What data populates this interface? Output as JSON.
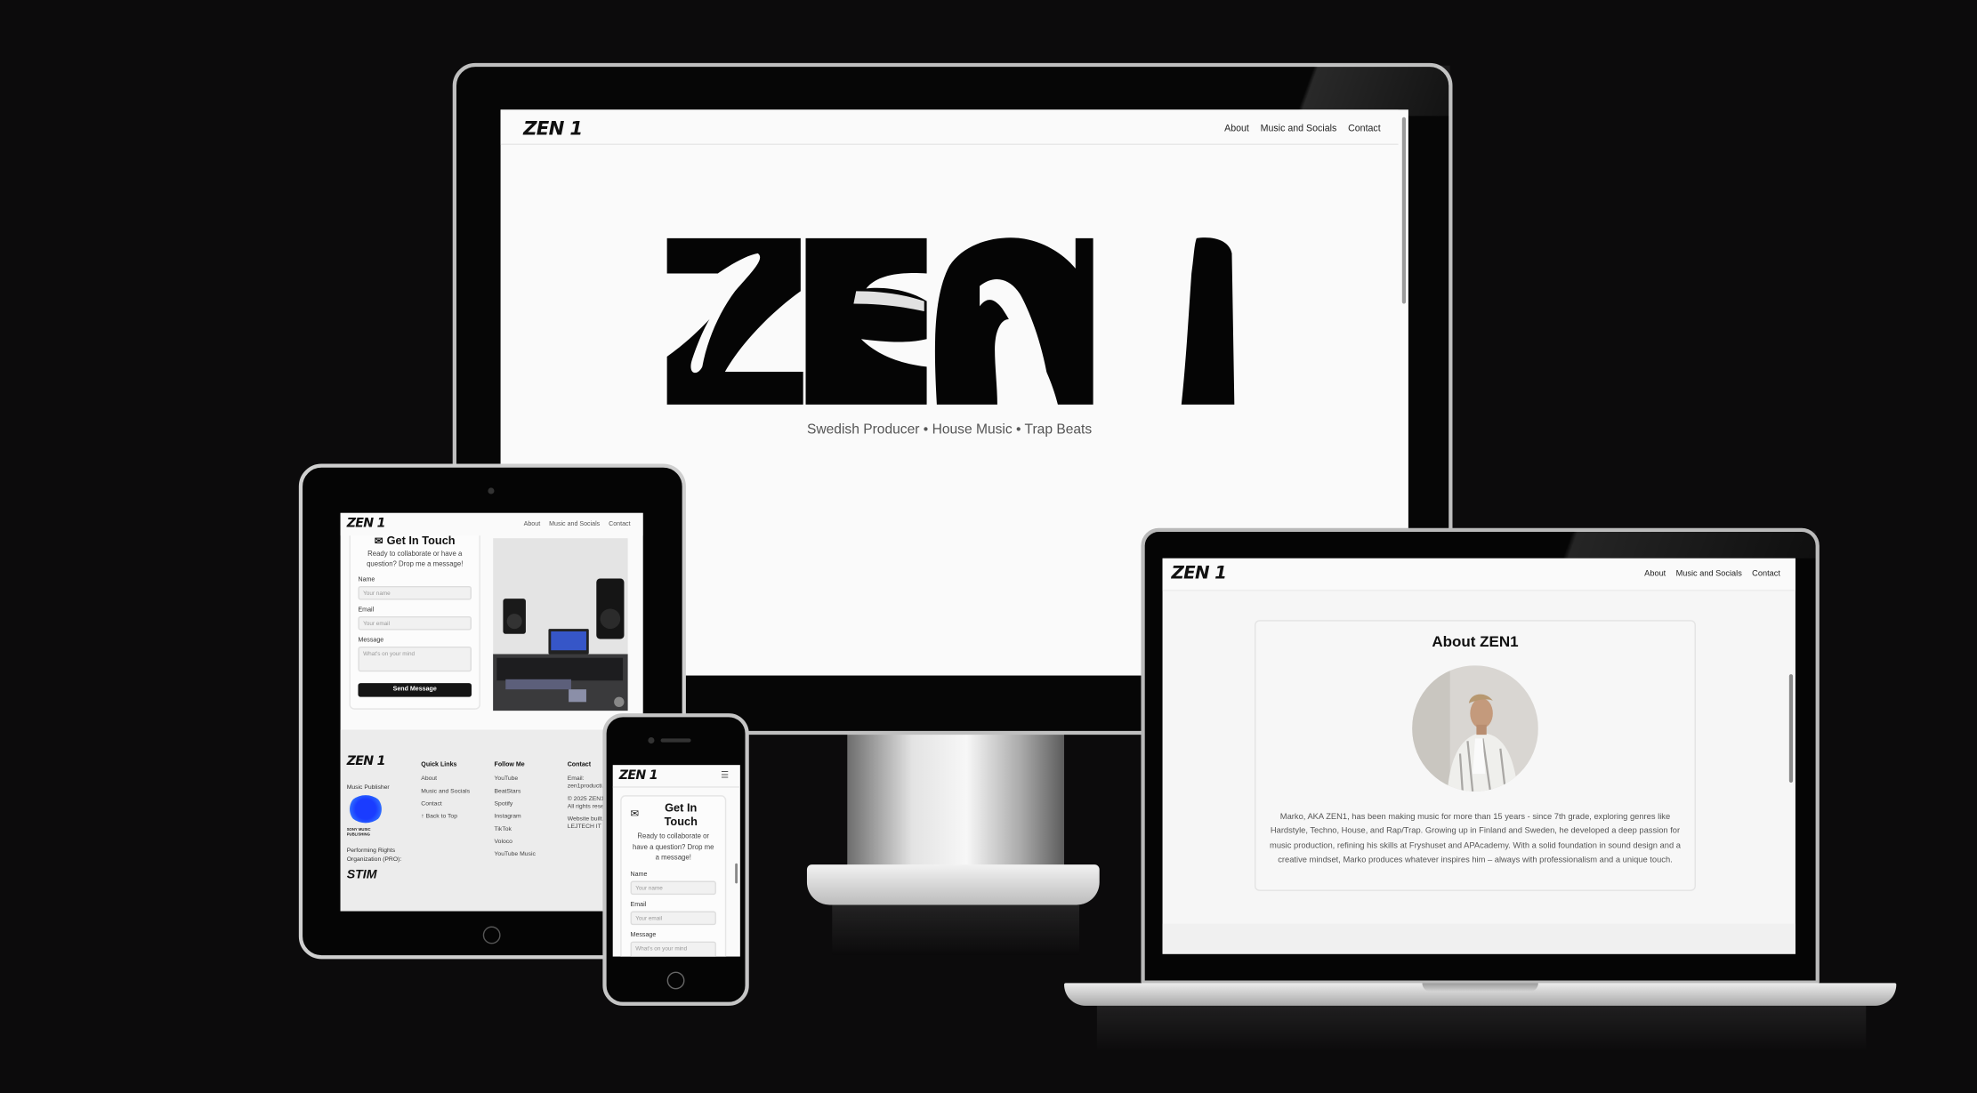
{
  "brand": {
    "logo_text": "ZEN 1",
    "hero_letters": "ZEN 1",
    "tagline": "Swedish Producer • House Music • Trap Beats"
  },
  "nav": {
    "about": "About",
    "music": "Music and Socials",
    "contact": "Contact"
  },
  "contact_form": {
    "title_partial": "Get In Touch",
    "title_line1": "Get In",
    "title_line2": "Touch",
    "subtitle": "Ready to collaborate or have a question? Drop me a message!",
    "name_label": "Name",
    "name_placeholder": "Your name",
    "email_label": "Email",
    "email_placeholder": "Your email",
    "message_label": "Message",
    "message_placeholder": "What's on your mind",
    "submit_label": "Send Message"
  },
  "footer": {
    "publisher_label": "Music Publisher",
    "publisher_logo_text": "SONY MUSIC PUBLISHING",
    "pro_label": "Performing Rights Organization (PRO):",
    "pro_logo_text": "STIM",
    "quick_links": {
      "heading": "Quick Links",
      "items": [
        "About",
        "Music and Socials",
        "Contact",
        "↑  Back to Top"
      ]
    },
    "follow": {
      "heading": "Follow Me",
      "items": [
        "YouTube",
        "BeatStars",
        "Spotify",
        "Instagram",
        "TikTok",
        "Voloco",
        "YouTube Music"
      ]
    },
    "contact": {
      "heading": "Contact",
      "email_line": "Email:",
      "email_partial": "zen1producti...",
      "copyright": "© 2025 ZEN1.",
      "rights": "All rights rese...",
      "built_by": "Website built...",
      "builder": "LEJTECH IT"
    }
  },
  "about": {
    "title": "About ZEN1",
    "bio": "Marko, AKA ZEN1, has been making music for more than 15 years - since 7th grade, exploring genres like Hardstyle, Techno, House, and Rap/Trap. Growing up in Finland and Sweden, he developed a deep passion for music production, refining his skills at Fryshuset and APAcademy. With a solid foundation in sound design and a creative mindset, Marko produces whatever inspires him – always with professionalism and a unique touch."
  },
  "icons": {
    "mail": "mail-icon",
    "menu": "menu-icon",
    "arrow_up": "arrow-up-icon"
  },
  "colors": {
    "background": "#0c0b0c",
    "page": "#fafafa",
    "ink": "#111111",
    "button": "#151515",
    "sony_blue": "#1a3cff"
  }
}
